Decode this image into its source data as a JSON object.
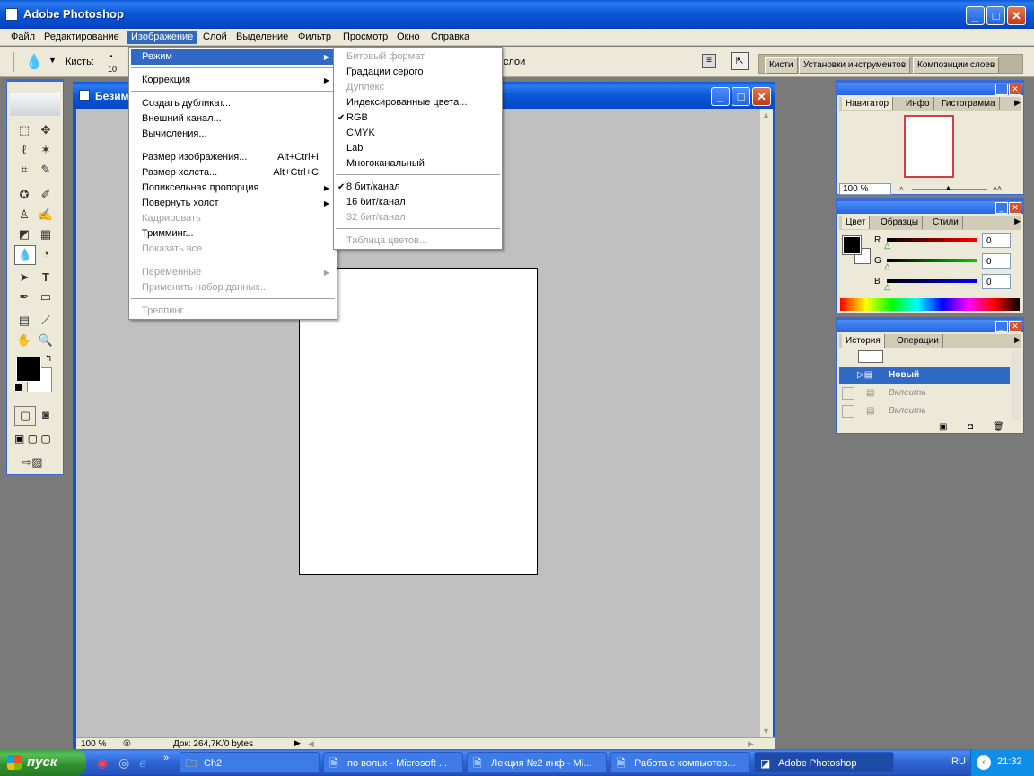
{
  "app": {
    "title": "Adobe Photoshop"
  },
  "menubar": [
    "Файл",
    "Редактирование",
    "Изображение",
    "Слой",
    "Выделение",
    "Фильтр",
    "Просмотр",
    "Окно",
    "Справка"
  ],
  "options_bar": {
    "brush_label": "Кисть:",
    "brush_size": "10",
    "layers_label": "слои"
  },
  "palette_well_tabs": [
    "Кисти",
    "Установки инструментов",
    "Композиции слоев"
  ],
  "document": {
    "title": "Безим",
    "zoom": "100 %",
    "doc_info": "Док: 264,7K/0 bytes"
  },
  "image_menu": {
    "items": [
      {
        "label": "Режим",
        "submenu": true,
        "highlight": true
      },
      {
        "label": "Коррекция",
        "submenu": true
      },
      {
        "label": "Создать дубликат..."
      },
      {
        "label": "Внешний канал..."
      },
      {
        "label": "Вычисления..."
      },
      {
        "label": "Размер изображения...",
        "shortcut": "Alt+Ctrl+I"
      },
      {
        "label": "Размер холста...",
        "shortcut": "Alt+Ctrl+C"
      },
      {
        "label": "Попиксельная пропорция",
        "submenu": true
      },
      {
        "label": "Повернуть холст",
        "submenu": true
      },
      {
        "label": "Кадрировать",
        "disabled": true
      },
      {
        "label": "Тримминг..."
      },
      {
        "label": "Показать все",
        "disabled": true
      },
      {
        "label": "Переменные",
        "submenu": true,
        "disabled": true
      },
      {
        "label": "Применить набор данных...",
        "disabled": true
      },
      {
        "label": "Треппинг...",
        "disabled": true
      }
    ]
  },
  "mode_submenu": {
    "items": [
      {
        "label": "Битовый формат",
        "disabled": true
      },
      {
        "label": "Градации серого"
      },
      {
        "label": "Дуплекс",
        "disabled": true
      },
      {
        "label": "Индексированные цвета..."
      },
      {
        "label": "RGB",
        "checked": true
      },
      {
        "label": "CMYK"
      },
      {
        "label": "Lab"
      },
      {
        "label": "Многоканальный"
      },
      {
        "label": "8 бит/канал",
        "checked": true
      },
      {
        "label": "16 бит/канал"
      },
      {
        "label": "32 бит/канал",
        "disabled": true
      },
      {
        "label": "Таблица цветов...",
        "disabled": true
      }
    ]
  },
  "navigator": {
    "tabs": [
      "Навигатор",
      "Инфо",
      "Гистограмма"
    ],
    "zoom": "100 %"
  },
  "color_palette": {
    "tabs": [
      "Цвет",
      "Образцы",
      "Стили"
    ],
    "channels": [
      {
        "name": "R",
        "value": "0"
      },
      {
        "name": "G",
        "value": "0"
      },
      {
        "name": "B",
        "value": "0"
      }
    ]
  },
  "history": {
    "tabs": [
      "История",
      "Операции"
    ],
    "items": [
      {
        "label": "Новый",
        "selected": true
      },
      {
        "label": "Вклеить"
      },
      {
        "label": "Вклеить"
      }
    ]
  },
  "taskbar": {
    "start": "пуск",
    "tasks": [
      "Ch2",
      "по вольх - Microsoft ...",
      "Лекция №2 инф - Mi...",
      "Работа с компьютер...",
      "Adobe Photoshop"
    ],
    "lang": "RU",
    "time": "21:32"
  },
  "colors": {
    "xp_blue": "#0a58d6",
    "menu_highlight": "#316ac5",
    "canvas_gray": "#c0c0c0"
  }
}
